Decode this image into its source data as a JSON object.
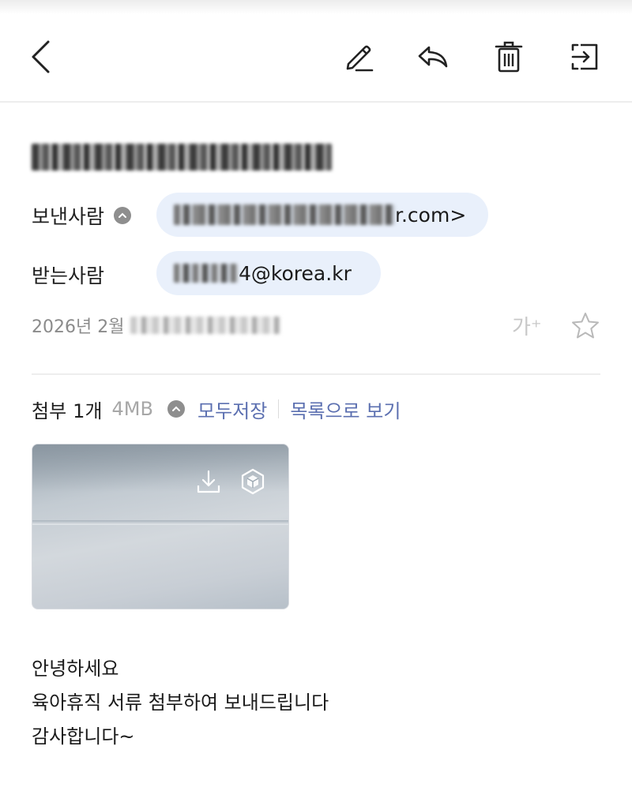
{
  "toolbar": {
    "back": "back-icon",
    "actions": [
      "edit-icon",
      "reply-icon",
      "trash-icon",
      "move-icon"
    ]
  },
  "header": {
    "sender_label": "보낸사람",
    "sender_visible": "r.com>",
    "recipient_label": "받는사람",
    "recipient_visible": "4@korea.kr",
    "date_visible": "2026년 2월",
    "font_size_label": "가⁺"
  },
  "attachments": {
    "label": "첨부",
    "count": "1개",
    "size": "4MB",
    "save_all": "모두저장",
    "view_list": "목록으로 보기"
  },
  "body": {
    "lines": [
      "안녕하세요",
      "육아휴직 서류 첨부하여 보내드립니다",
      "감사합니다~"
    ]
  },
  "colors": {
    "accent": "#5b6fb0",
    "chip_bg": "#e9f0fb",
    "muted": "#8b8b8b"
  }
}
